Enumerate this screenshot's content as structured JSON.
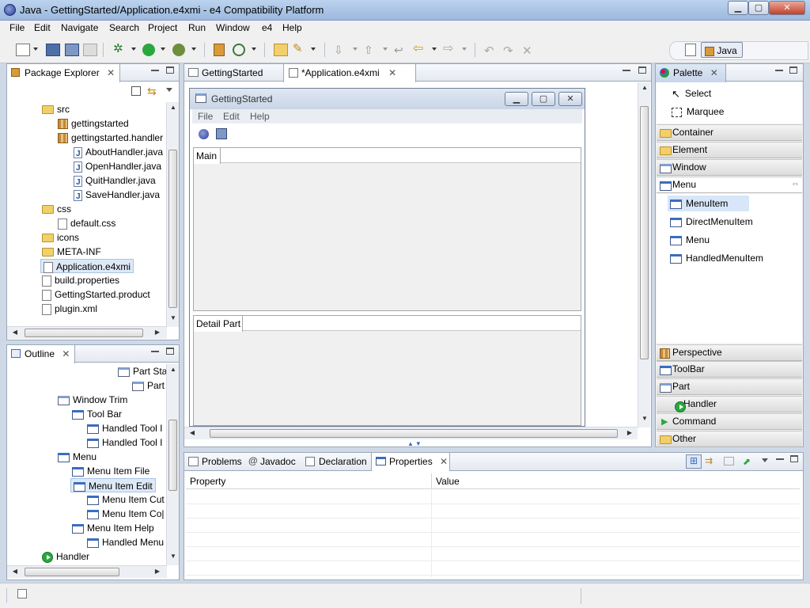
{
  "window": {
    "title": "Java - GettingStarted/Application.e4xmi - e4 Compatibility Platform",
    "minimize": "▁",
    "maximize": "▢",
    "close": "✕"
  },
  "menubar": [
    "File",
    "Edit",
    "Navigate",
    "Search",
    "Project",
    "Run",
    "Window",
    "e4",
    "Help"
  ],
  "perspective": {
    "label": "Java"
  },
  "package_explorer": {
    "tab": "Package Explorer",
    "items": [
      {
        "label": "src",
        "icon": "source-folder-icon"
      },
      {
        "label": "gettingstarted",
        "icon": "package-icon"
      },
      {
        "label": "gettingstarted.handler",
        "icon": "package-icon"
      },
      {
        "label": "AboutHandler.java",
        "icon": "java-file-icon"
      },
      {
        "label": "OpenHandler.java",
        "icon": "java-file-icon"
      },
      {
        "label": "QuitHandler.java",
        "icon": "java-file-icon"
      },
      {
        "label": "SaveHandler.java",
        "icon": "java-file-icon"
      },
      {
        "label": "css",
        "icon": "folder-icon"
      },
      {
        "label": "default.css",
        "icon": "css-file-icon"
      },
      {
        "label": "icons",
        "icon": "folder-icon"
      },
      {
        "label": "META-INF",
        "icon": "folder-icon"
      },
      {
        "label": "Application.e4xmi",
        "icon": "e4xmi-file-icon"
      },
      {
        "label": "build.properties",
        "icon": "properties-file-icon"
      },
      {
        "label": "GettingStarted.product",
        "icon": "product-file-icon"
      },
      {
        "label": "plugin.xml",
        "icon": "xml-file-icon"
      }
    ]
  },
  "outline": {
    "tab": "Outline",
    "items": [
      {
        "label": "Part Sta",
        "icon": "part-stack-icon"
      },
      {
        "label": "Part",
        "icon": "part-icon"
      },
      {
        "label": "Window Trim",
        "icon": "window-icon"
      },
      {
        "label": "Tool Bar",
        "icon": "toolbar-icon"
      },
      {
        "label": "Handled Tool I",
        "icon": "tool-item-icon"
      },
      {
        "label": "Handled Tool I",
        "icon": "tool-item-icon"
      },
      {
        "label": "Menu",
        "icon": "menu-icon"
      },
      {
        "label": "Menu Item File",
        "icon": "menu-item-icon"
      },
      {
        "label": "Menu Item Edit",
        "icon": "menu-item-icon"
      },
      {
        "label": "Menu Item Cut",
        "icon": "menu-item-icon"
      },
      {
        "label": "Menu Item Co|",
        "icon": "menu-item-icon"
      },
      {
        "label": "Menu Item Help",
        "icon": "menu-item-icon"
      },
      {
        "label": "Handled Menu",
        "icon": "menu-item-icon"
      },
      {
        "label": "Handler",
        "icon": "handler-icon"
      }
    ]
  },
  "editor": {
    "tabs": [
      "GettingStarted",
      "*Application.e4xmi"
    ],
    "preview": {
      "title": "GettingStarted",
      "menu": [
        "File",
        "Edit",
        "Help"
      ],
      "main_tab": "Main",
      "detail_tab": "Detail Part"
    }
  },
  "palette": {
    "tab": "Palette",
    "tools": [
      "Select",
      "Marquee"
    ],
    "sections": [
      "Container",
      "Element",
      "Window",
      "Menu",
      "Perspective",
      "ToolBar",
      "Part",
      "Handler",
      "Command",
      "Other"
    ],
    "menu_items": [
      "MenuItem",
      "DirectMenuItem",
      "Menu",
      "HandledMenuItem"
    ]
  },
  "bottom": {
    "tabs": [
      "Problems",
      "Javadoc",
      "Declaration",
      "Properties"
    ],
    "columns": [
      "Property",
      "Value"
    ]
  }
}
